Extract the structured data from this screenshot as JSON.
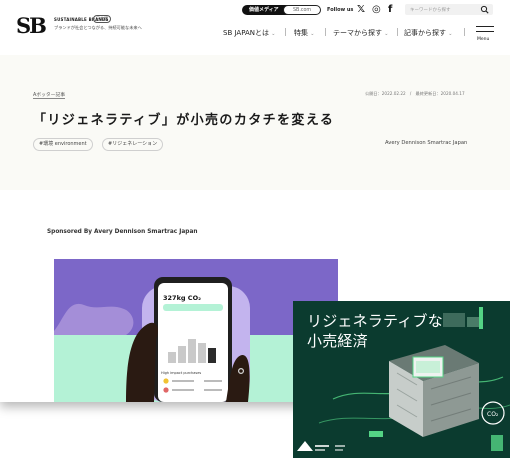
{
  "header": {
    "logo": "SB",
    "brand_name": "SUSTAINABLE BRANDS",
    "brand_tag": "日本版",
    "brand_sub": "ブランドが社会とつながる、持続可能な未来へ",
    "media_pill": "価値メディア",
    "site_pill": "SB.com",
    "follow_label": "Follow us",
    "sns": {
      "x": "𝕏",
      "instagram": "◎",
      "facebook": "f"
    },
    "search_placeholder": "キーワードから探す",
    "nav": [
      "SB JAPANとは",
      "特集",
      "テーマから探す",
      "記事から探す"
    ],
    "nav_chevron": "⌄",
    "menu_label": "Menu"
  },
  "article": {
    "category": "Aボッター記事",
    "dates": "公開日：2022.02.22　/　最終更新日：2020.04.17",
    "title": "「リジェネラティブ」が小売のカタチを変える",
    "tags": [
      "#環境 environment",
      "#リジェネレーション"
    ],
    "author": "Avery Dennison Smartrac Japan",
    "sponsored": "Sponsored By Avery Dennison Smartrac Japan"
  },
  "hero": {
    "value": "327kg CO₂",
    "card_label": "High impact purchases"
  },
  "overlay": {
    "text_line1": "リジェネラティブな",
    "text_line2": "小売経済",
    "bubble": "CO₂"
  },
  "colors": {
    "hero_bg": "#7c67c8",
    "mint": "#b4f2d6",
    "overlay_bg": "#0b3b2f",
    "accent_green": "#54d485"
  }
}
